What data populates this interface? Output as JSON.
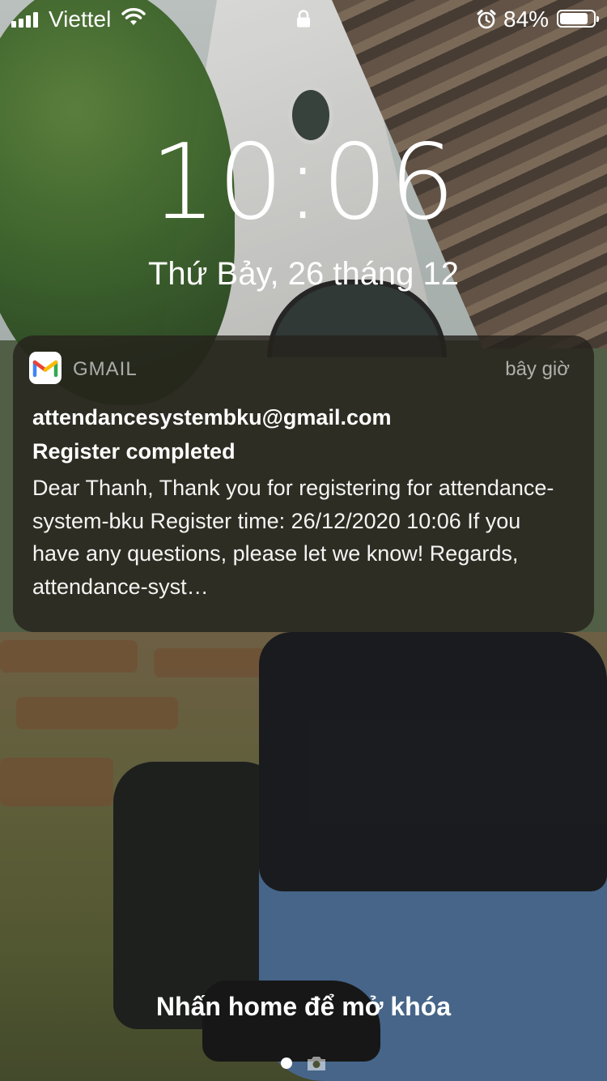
{
  "status_bar": {
    "carrier": "Viettel",
    "battery_percent": "84%",
    "battery_level": 0.84
  },
  "lock_screen": {
    "time": "10:06",
    "date": "Thứ Bảy, 26 tháng 12"
  },
  "notification": {
    "app_name": "GMAIL",
    "time_ago": "bây giờ",
    "sender": "attendancesystembku@gmail.com",
    "subject": "Register completed",
    "body": "Dear Thanh, Thank you for registering for attendance-system-bku Register time: 26/12/2020 10:06 If you have any questions, please let we know! Regards, attendance-syst…",
    "icon": "gmail-icon"
  },
  "bottom": {
    "unlock_hint": "Nhấn home để mở khóa"
  },
  "icons": [
    "signal-icon",
    "wifi-icon",
    "lock-icon",
    "alarm-icon",
    "battery-icon",
    "gmail-icon",
    "camera-icon"
  ]
}
